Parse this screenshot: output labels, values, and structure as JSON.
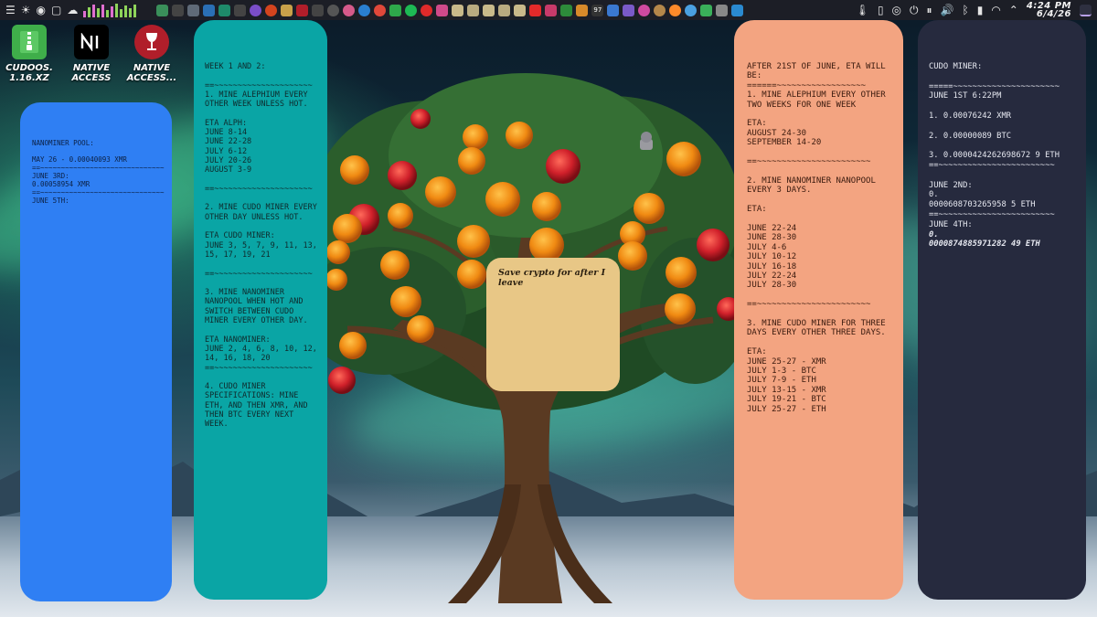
{
  "topbar": {
    "clock_time": "4:24 PM",
    "clock_date": "6/4/26",
    "audio_bars": [
      0.45,
      0.7,
      0.9,
      0.6,
      0.85,
      0.5,
      0.75,
      0.95,
      0.55,
      0.8,
      0.65,
      0.9
    ],
    "tray_badge": "97",
    "colors": {
      "bar_background": "#1c1e26",
      "bars_a": "#e06fd0",
      "bars_b": "#8fd45a"
    }
  },
  "desktop_icons": [
    {
      "label": "cudoos.\n1.16.xz",
      "icon": "zip-archive-icon",
      "color": "#3fae4a"
    },
    {
      "label": "Native\nAccess",
      "icon": "native-instruments-icon",
      "color": "#000000"
    },
    {
      "label": "Native\nAccess...",
      "icon": "wine-glass-icon",
      "color": "#b01e2a"
    }
  ],
  "notes": {
    "blue": {
      "color": "#2f7ff3",
      "text": "Nanominer Pool:\n\nMay 26 - 0.00040093 XMR\n==~~~~~~~~~~~~~~~~~~~~~~~~~~~~~~\nJune 3rd:\n0.00058954 XMR\n==~~~~~~~~~~~~~~~~~~~~~~~~~~~~~~\nJune 5th:"
    },
    "teal": {
      "color": "#0aa5a5",
      "text": "Week 1 and 2:\n\n==~~~~~~~~~~~~~~~~~~~~~\n1. Mine Alephium every other week unless hot.\n\nETA Alph:\nJune 8-14\nJune 22-28\nJuly 6-12\nJuly 20-26\nAugust 3-9\n\n==~~~~~~~~~~~~~~~~~~~~~\n\n2. Mine Cudo Miner every other day unless hot.\n\nETA Cudo Miner:\nJune 3, 5, 7, 9, 11, 13, 15, 17, 19, 21\n\n==~~~~~~~~~~~~~~~~~~~~~\n\n3. Mine Nanominer Nanopool when hot and switch between Cudo Miner every other day.\n\nETA Nanominer:\nJune 2, 4, 6, 8, 10, 12, 14, 16, 18, 20\n==~~~~~~~~~~~~~~~~~~~~~\n\n4. Cudo Miner Specifications: mine ETH, and then XMR, and then BTC every next week."
    },
    "yellow": {
      "color": "#e8c786",
      "text": "Save crypto for after I leave"
    },
    "orange": {
      "color": "#f3a481",
      "text": "After 21st of June, ETA will be:\n======~~~~~~~~~~~~~~~~~~\n1. Mine Alephium every other two weeks for one week\n\nETA:\nAugust 24-30\nSeptember 14-20\n\n==~~~~~~~~~~~~~~~~~~~~~~~\n\n2. Mine Nanominer Nanopool every 3 days.\n\nETA:\n\nJune 22-24\nJune 28-30\nJuly 4-6\nJuly 10-12\nJuly 16-18\nJuly 22-24\nJuly 28-30\n\n==~~~~~~~~~~~~~~~~~~~~~~~\n\n3. Mine Cudo Miner for three days every other three days.\n\nETA:\nJune 25-27 - XMR\nJuly 1-3 - BTC\nJuly 7-9 - ETH\nJuly 13-15 - XMR\nJuly 19-21 - BTC\nJuly 25-27 - ETH"
    },
    "dark": {
      "color": "#262a3e",
      "text": "Cudo Miner:\n\n=====~~~~~~~~~~~~~~~~~~~~~~\nJune 1st 6:22PM\n\n1. 0.00076242 XMR\n\n2. 0.00000089 BTC\n\n3. 0.0000424262698672 9 ETH\n==~~~~~~~~~~~~~~~~~~~~~~~~\n\nJune 2nd:\n0.\n0000608703265958 5 ETH\n==~~~~~~~~~~~~~~~~~~~~~~~~\nJune 4th:",
      "text_bold": "0.\n0000874885971282 49 ETH"
    }
  }
}
